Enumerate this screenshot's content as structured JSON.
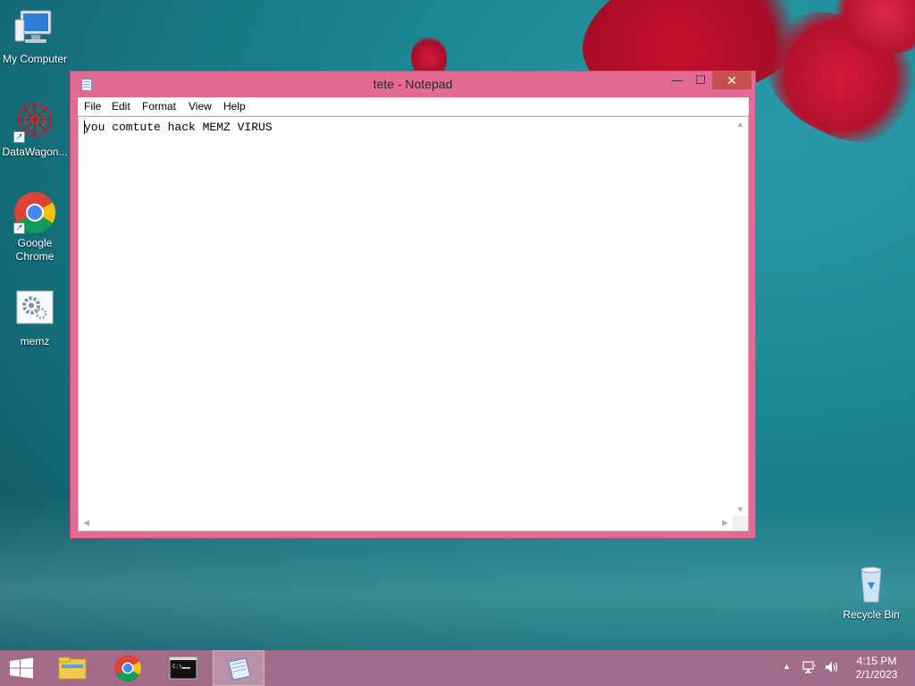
{
  "desktop": {
    "icons": [
      {
        "label": "My Computer"
      },
      {
        "label": "DataWagon..."
      },
      {
        "label": "Google Chrome"
      },
      {
        "label": "memz"
      },
      {
        "label": "Recycle Bin"
      }
    ]
  },
  "window": {
    "title": "tete - Notepad",
    "controls": {
      "minimize": "—",
      "maximize": "☐",
      "close": "✕"
    },
    "menu": [
      "File",
      "Edit",
      "Format",
      "View",
      "Help"
    ],
    "content": "you comtute hack MEMZ VIRUS"
  },
  "taskbar": {
    "pinned": [
      "file-explorer-icon",
      "chrome-icon",
      "command-prompt-icon",
      "notepad-icon"
    ],
    "active": "notepad-icon",
    "tray": {
      "arrow": "▲",
      "time": "4:15 PM",
      "date": "2/1/2023"
    }
  },
  "colors": {
    "window_frame": "#e46a96",
    "close_button": "#c7504f",
    "taskbar": "#af6e8c"
  }
}
